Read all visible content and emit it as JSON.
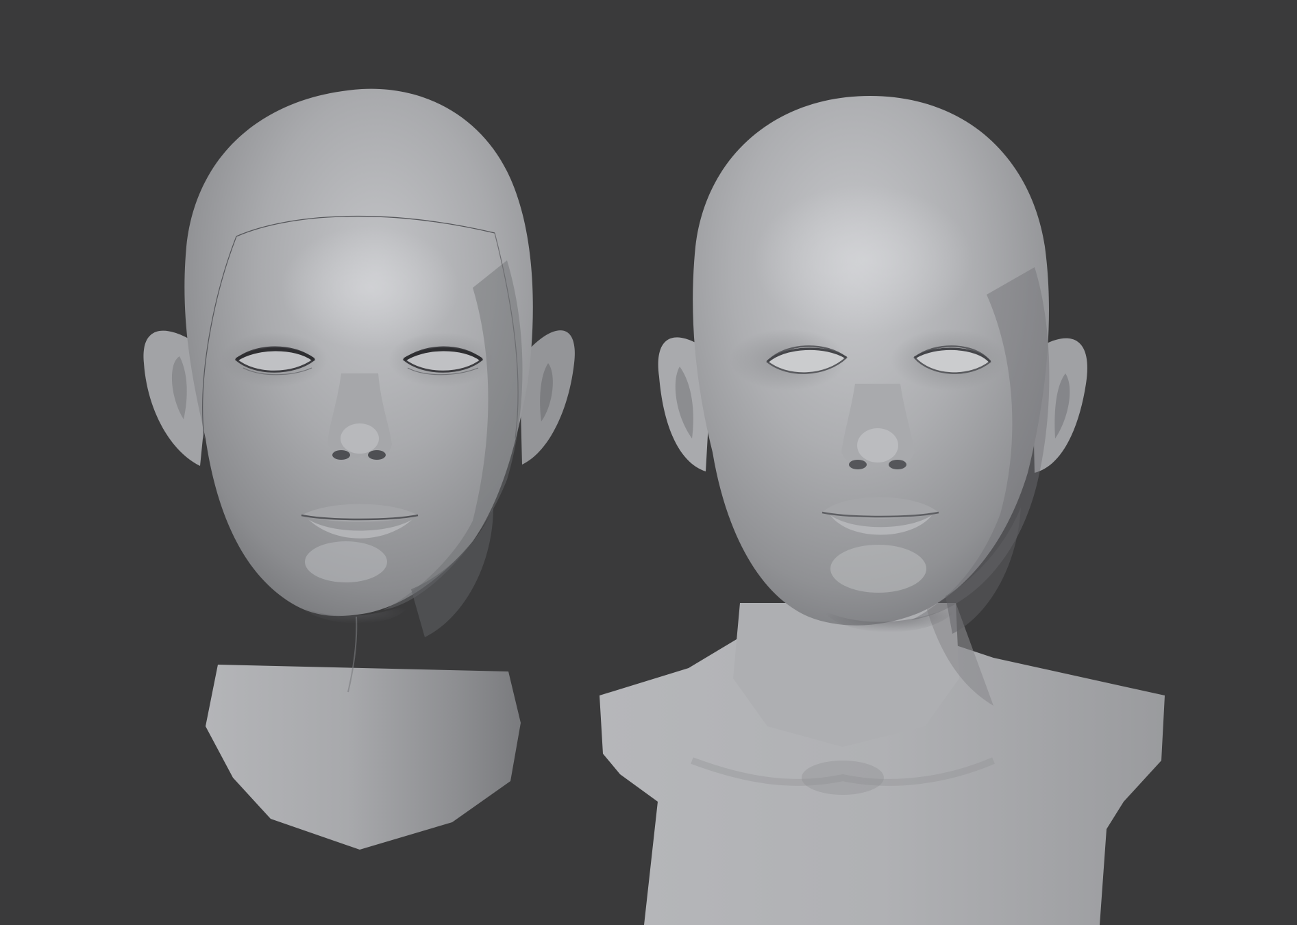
{
  "scene": {
    "background_color": "#3a3a3b",
    "model_color": "#a9aaad",
    "objects": [
      {
        "name": "head-sculpt-left"
      },
      {
        "name": "head-sculpt-right"
      }
    ]
  }
}
